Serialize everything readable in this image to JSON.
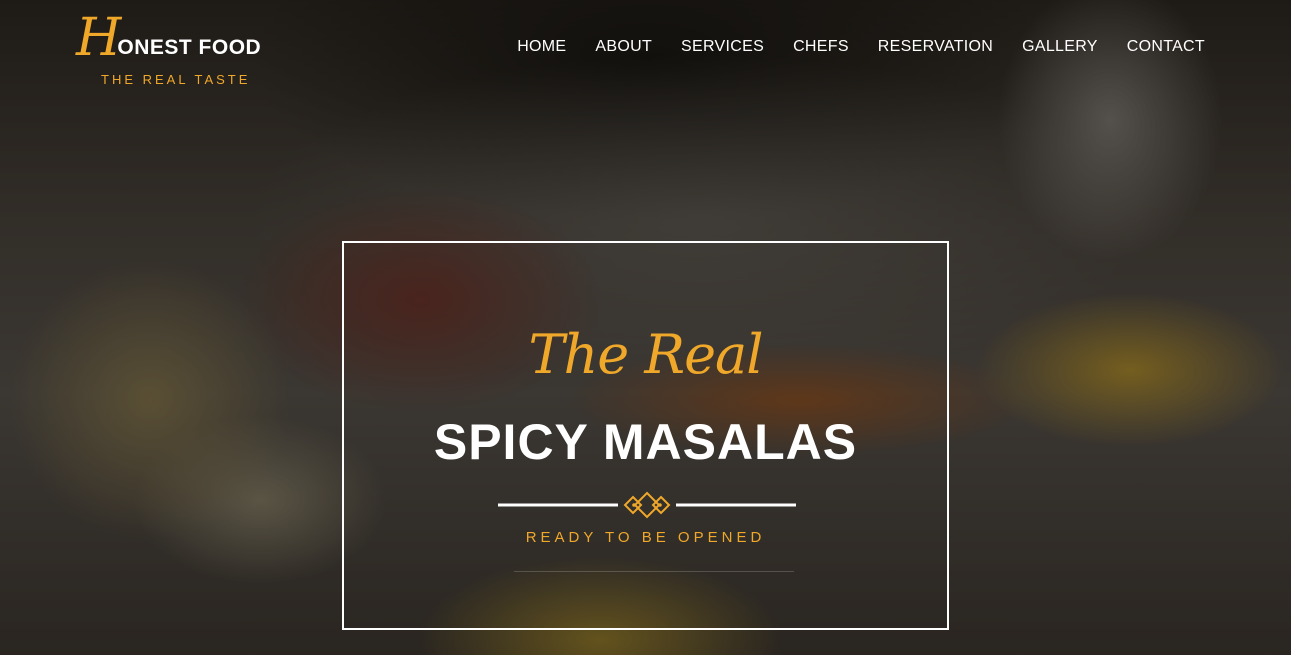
{
  "brand": {
    "initial": "H",
    "name": "ONEST FOOD",
    "tagline": "THE REAL TASTE"
  },
  "nav": {
    "items": [
      {
        "label": "HOME"
      },
      {
        "label": "ABOUT"
      },
      {
        "label": "SERVICES"
      },
      {
        "label": "CHEFS"
      },
      {
        "label": "RESERVATION"
      },
      {
        "label": "GALLERY"
      },
      {
        "label": "CONTACT"
      }
    ]
  },
  "hero": {
    "script_title": "The Real",
    "title": "SPICY MASALAS",
    "subtitle": "READY TO BE OPENED"
  },
  "colors": {
    "accent": "#f0a82a",
    "text": "#ffffff"
  }
}
